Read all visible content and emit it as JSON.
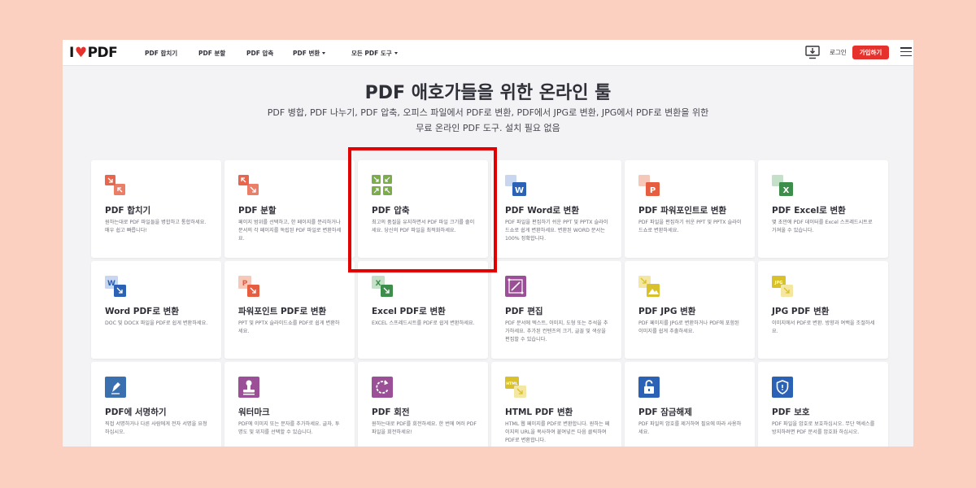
{
  "header": {
    "logo_prefix": "I",
    "logo_heart": "♥",
    "logo_suffix": "PDF",
    "nav": [
      "PDF 합치기",
      "PDF 분할",
      "PDF 압축",
      "PDF 변환",
      "모든 PDF 도구"
    ],
    "login": "로그인",
    "signup": "가입하기"
  },
  "hero": {
    "title": "PDF 애호가들을 위한 온라인 툴",
    "subtitle": "PDF 병합, PDF 나누기, PDF 압축, 오피스 파일에서 PDF로 변환, PDF에서 JPG로 변환, JPG에서 PDF로 변환을 위한 무료 온라인 PDF 도구. 설치 필요 없음"
  },
  "tools": [
    {
      "title": "PDF 합치기",
      "desc": "원하는대로 PDF 파일들을 병합하고 통합하세요. 매우 쉽고 빠릅니다!",
      "icon": "merge-icon",
      "color": "#e8674c"
    },
    {
      "title": "PDF 분할",
      "desc": "페이지 범위를 선택하고, 한 페이지를 분리하거나 문서의 각 페이지를 독립된 PDF 파일로 변환하세요.",
      "icon": "split-icon",
      "color": "#e8674c"
    },
    {
      "title": "PDF 압축",
      "desc": "최고의 품질을 유지하면서 PDF 파일 크기를 줄이세요. 당신의 PDF 파일을 최적화하세요.",
      "icon": "compress-icon",
      "color": "#7bae4a"
    },
    {
      "title": "PDF Word로 변환",
      "desc": "PDF 파일을 편집하기 쉬운 PPT 및 PPTX 슬라이드쇼로 쉽게 변환하세요. 변환된 WORD 문서는 100% 정확합니다.",
      "icon": "word-icon",
      "color": "#2b62b6"
    },
    {
      "title": "PDF 파워포인트로 변환",
      "desc": "PDF 파일을 편집하기 쉬운 PPT 및 PPTX 슬라이드쇼로 변환하세요.",
      "icon": "powerpoint-icon",
      "color": "#e65e3f"
    },
    {
      "title": "PDF Excel로 변환",
      "desc": "몇 초만에 PDF 데이터를 Excel 스프레드시트로 가져올 수 있습니다.",
      "icon": "excel-icon",
      "color": "#3e8e4b"
    },
    {
      "title": "Word PDF로 변환",
      "desc": "DOC 및 DOCX 파일을 PDF로 쉽게 변환하세요.",
      "icon": "word-to-pdf-icon",
      "color": "#2b62b6"
    },
    {
      "title": "파워포인트 PDF로 변환",
      "desc": "PPT 및 PPTX 슬라이드쇼를 PDF로 쉽게 변환하세요.",
      "icon": "powerpoint-to-pdf-icon",
      "color": "#e65e3f"
    },
    {
      "title": "Excel PDF로 변환",
      "desc": "EXCEL 스프레드시트를 PDF로 쉽게 변환하세요.",
      "icon": "excel-to-pdf-icon",
      "color": "#3e8e4b"
    },
    {
      "title": "PDF 편집",
      "desc": "PDF 문서에 텍스트, 이미지, 도형 또는 주석을 추가하세요. 추가된 컨텐츠의 크기, 글꼴 및 색상을 편집할 수 있습니다.",
      "icon": "edit-icon",
      "color": "#9b4f96"
    },
    {
      "title": "PDF JPG 변환",
      "desc": "PDF 페이지를 JPG로 변환하거나 PDF에 포함된 이미지를 쉽게 추출하세요.",
      "icon": "pdf-to-jpg-icon",
      "color": "#d9c12b"
    },
    {
      "title": "JPG PDF 변환",
      "desc": "이미지에서 PDF로 변환. 방향과 여백을 조절하세요.",
      "icon": "jpg-to-pdf-icon",
      "color": "#d9c12b"
    },
    {
      "title": "PDF에 서명하기",
      "desc": "직접 서명하거나 다른 사람에게 전자 서명을 요청하십시오.",
      "icon": "sign-icon",
      "color": "#3a6fb0"
    },
    {
      "title": "워터마크",
      "desc": "PDF에 이미지 또는 문자를 추가하세요. 글자, 투명도 및 위치를 선택할 수 있습니다.",
      "icon": "watermark-icon",
      "color": "#9b4f96"
    },
    {
      "title": "PDF 회전",
      "desc": "원하는대로 PDF를 회전하세요. 한 번에 여러 PDF 파일을 회전하세요!",
      "icon": "rotate-icon",
      "color": "#9b4f96"
    },
    {
      "title": "HTML PDF 변환",
      "desc": "HTML 웹 페이지를 PDF로 변환합니다. 원하는 페이지의 URL을 복사하여 붙여넣은 다음 클릭하여 PDF로 변환합니다.",
      "icon": "html-icon",
      "color": "#d9c12b"
    },
    {
      "title": "PDF 잠금해제",
      "desc": "PDF 파일의 암호를 제거하여 필요에 따라 사용하세요.",
      "icon": "unlock-icon",
      "color": "#2b62b6"
    },
    {
      "title": "PDF 보호",
      "desc": "PDF 파일을 암호로 보호하십시오. 무단 액세스를 방지하려면 PDF 문서를 암호화 하십시오.",
      "icon": "protect-icon",
      "color": "#2b62b6"
    }
  ],
  "highlight_target": "PDF 압축"
}
